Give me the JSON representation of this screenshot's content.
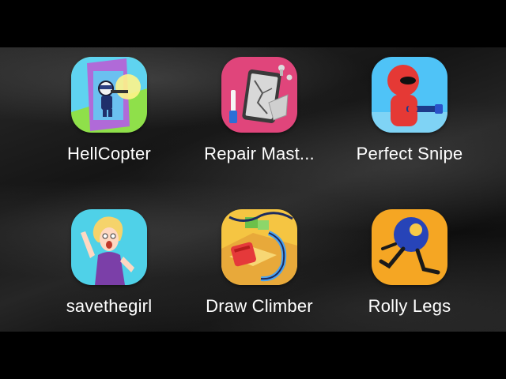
{
  "apps": [
    {
      "label": "HellCopter",
      "icon": "hellcopter-icon",
      "color": "#7ed321"
    },
    {
      "label": "Repair Mast...",
      "icon": "repair-master-icon",
      "color": "#e0457b"
    },
    {
      "label": "Perfect Snipe",
      "icon": "perfect-snipe-icon",
      "color": "#4fc3f7"
    },
    {
      "label": "savethegirl",
      "icon": "save-the-girl-icon",
      "color": "#4fd1e8"
    },
    {
      "label": "Draw Climber",
      "icon": "draw-climber-icon",
      "color": "#f5c542"
    },
    {
      "label": "Rolly Legs",
      "icon": "rolly-legs-icon",
      "color": "#f5a623"
    }
  ]
}
